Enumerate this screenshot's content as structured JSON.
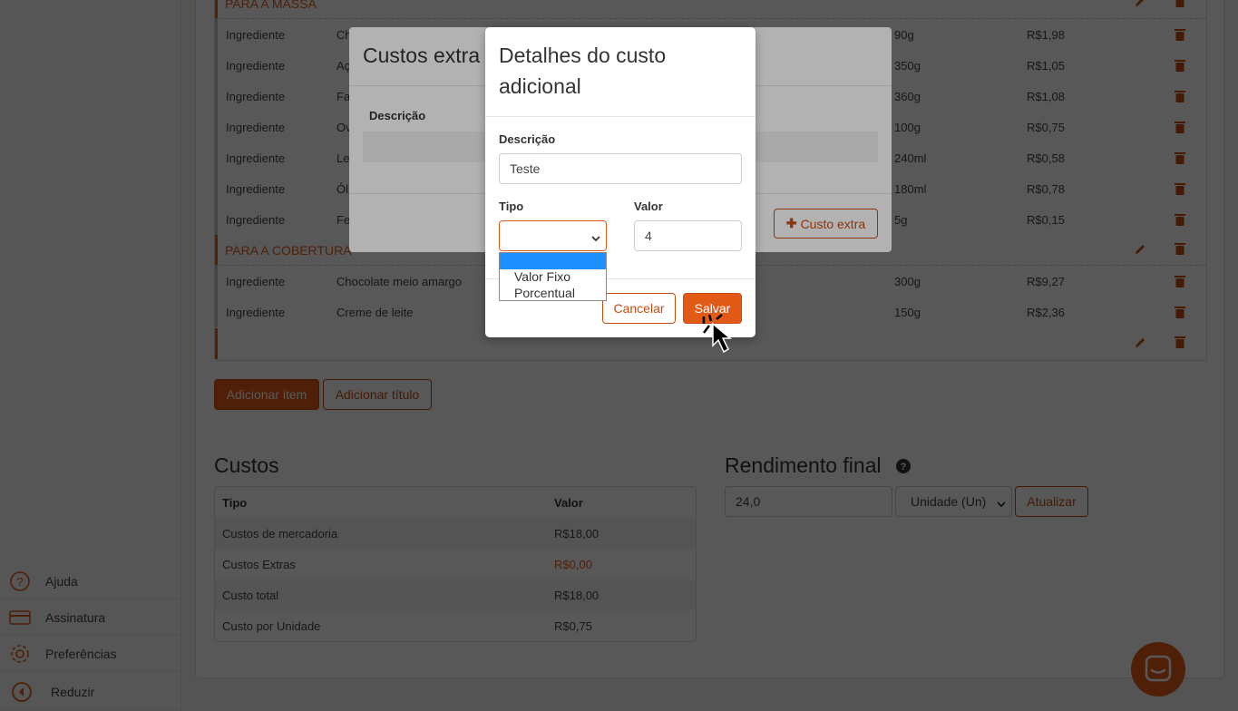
{
  "sidebar": {
    "items": [
      {
        "label": "Ajuda",
        "icon": "help-icon"
      },
      {
        "label": "Assinatura",
        "icon": "credit-card-icon"
      },
      {
        "label": "Preferências",
        "icon": "gear-icon"
      },
      {
        "label": "Reduzir",
        "icon": "collapse-icon"
      }
    ]
  },
  "recipe": {
    "sections": [
      {
        "title": "PARA A MASSA"
      },
      {
        "title": "PARA A COBERTURA"
      },
      {
        "title": ""
      }
    ],
    "massa_rows": [
      {
        "type": "Ingrediente",
        "name": "Ch",
        "qty": "90g",
        "price": "R$1,98"
      },
      {
        "type": "Ingrediente",
        "name": "Aç",
        "qty": "350g",
        "price": "R$1,05"
      },
      {
        "type": "Ingrediente",
        "name": "Fa",
        "qty": "360g",
        "price": "R$1,08"
      },
      {
        "type": "Ingrediente",
        "name": "Ov",
        "qty": "100g",
        "price": "R$0,75"
      },
      {
        "type": "Ingrediente",
        "name": "Le",
        "qty": "240ml",
        "price": "R$0,58"
      },
      {
        "type": "Ingrediente",
        "name": "Ól",
        "qty": "180ml",
        "price": "R$0,78"
      },
      {
        "type": "Ingrediente",
        "name": "Fe",
        "qty": "5g",
        "price": "R$0,15"
      }
    ],
    "cobertura_rows": [
      {
        "type": "Ingrediente",
        "name": "Chocolate meio amargo",
        "qty": "300g",
        "price": "R$9,27"
      },
      {
        "type": "Ingrediente",
        "name": "Creme de leite",
        "qty": "150g",
        "price": "R$2,36"
      }
    ]
  },
  "actions": {
    "add_item": "Adicionar item",
    "add_title": "Adicionar título"
  },
  "costs": {
    "heading": "Custos",
    "col_type": "Tipo",
    "col_value": "Valor",
    "rows": [
      {
        "label": "Custos de mercadoria",
        "value": "R$18,00"
      },
      {
        "label": "Custos Extras",
        "value": "R$0,00"
      },
      {
        "label": "Custo total",
        "value": "R$18,00"
      },
      {
        "label": "Custo por Unidade",
        "value": "R$0,75"
      }
    ]
  },
  "yield": {
    "heading": "Rendimento final",
    "value": "24,0",
    "unit": "Unidade (Un)",
    "update_label": "Atualizar"
  },
  "extra_costs_modal": {
    "title": "Custos extra",
    "col_desc": "Descrição",
    "add_label": "Custo extra"
  },
  "detail_modal": {
    "title": "Detalhes do custo adicional",
    "desc_label": "Descrição",
    "desc_value": "Teste",
    "type_label": "Tipo",
    "value_label": "Valor",
    "value_value": "4",
    "type_options": [
      "",
      "Valor Fixo",
      "Porcentual"
    ],
    "cancel_label": "Cancelar",
    "save_label": "Salvar"
  },
  "colors": {
    "accent": "#e35a16",
    "accent_dark": "#c94c0f",
    "dropdown_highlight": "#1e90ff"
  }
}
